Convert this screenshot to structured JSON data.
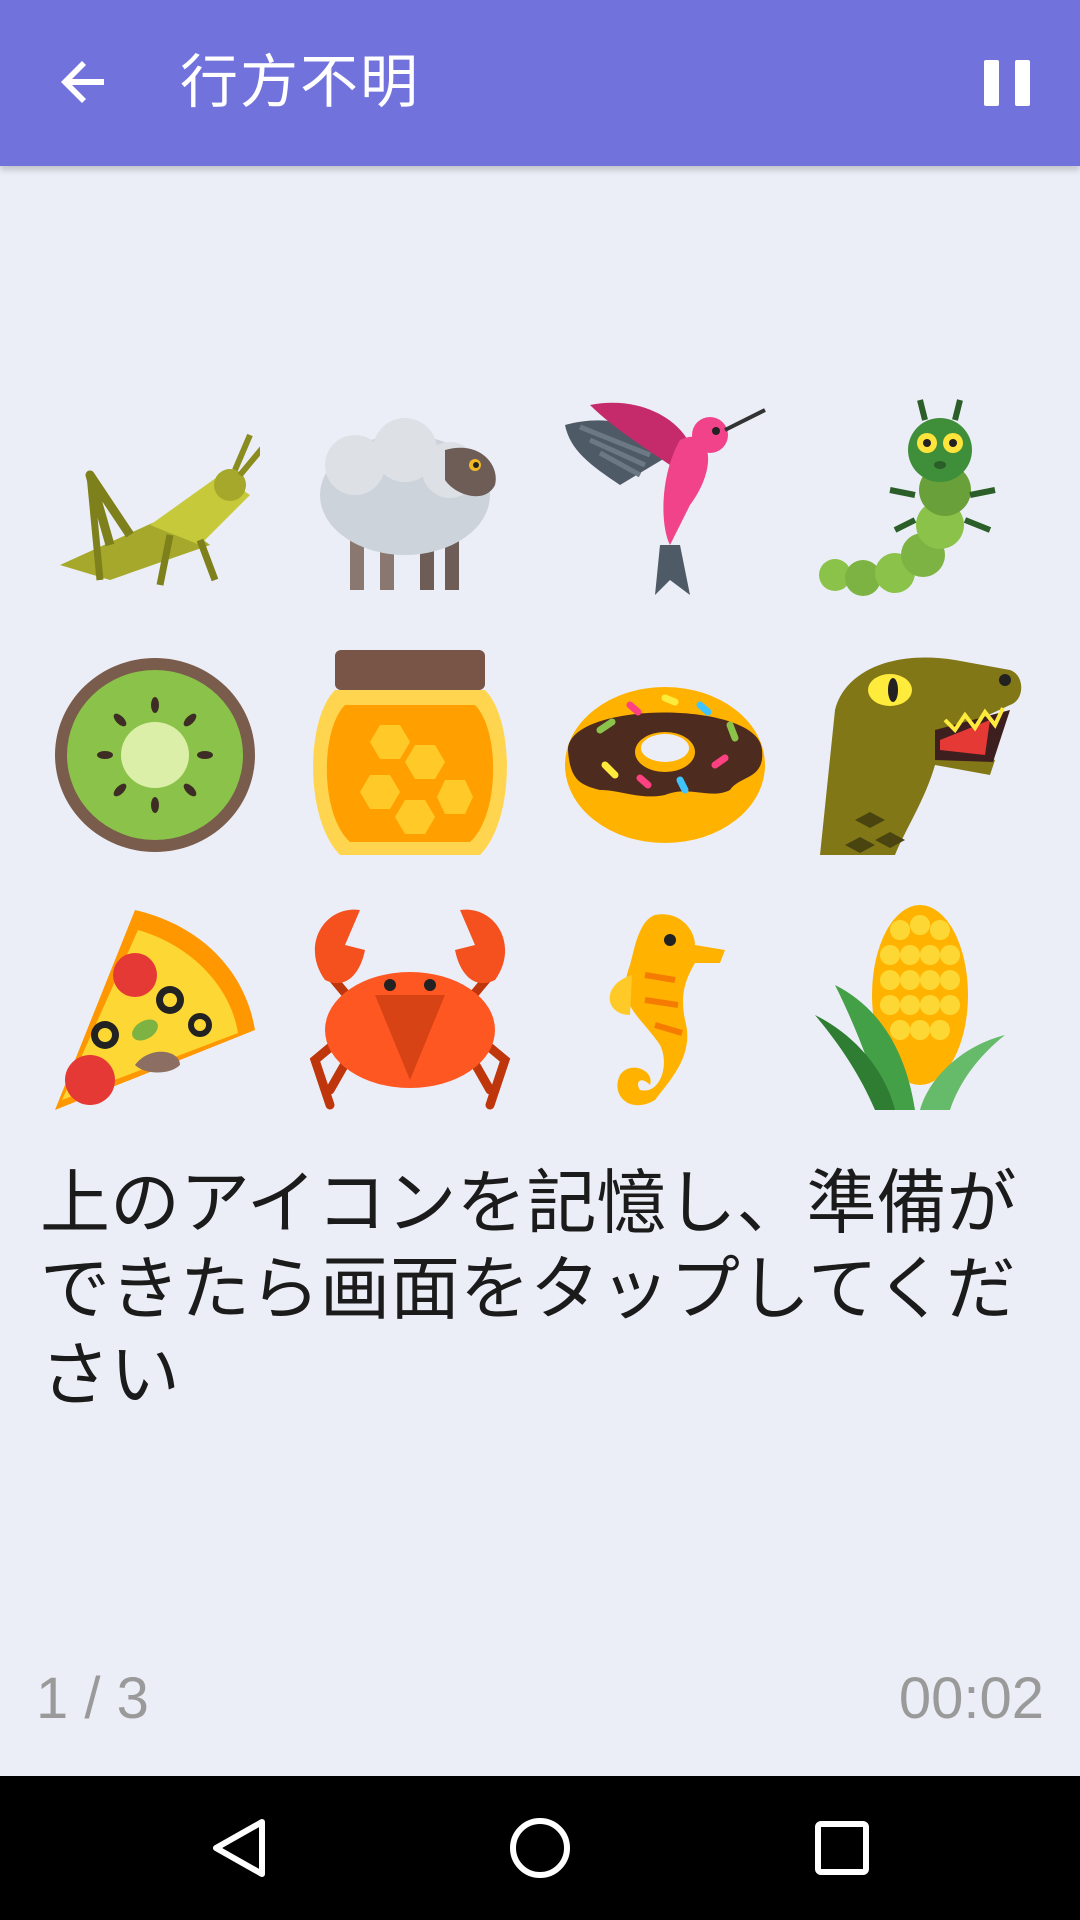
{
  "appbar": {
    "title": "行方不明",
    "back_icon": "arrow-back-icon",
    "pause_icon": "pause-icon",
    "background": "#7172dc"
  },
  "icons": [
    "grasshopper-icon",
    "sheep-icon",
    "hummingbird-icon",
    "caterpillar-icon",
    "kiwi-icon",
    "honey-jar-icon",
    "donut-icon",
    "dinosaur-icon",
    "pizza-icon",
    "crab-icon",
    "seahorse-icon",
    "corn-icon"
  ],
  "instruction": "上のアイコンを記憶し、準備ができたら画面をタップしてください",
  "footer": {
    "progress": "1 / 3",
    "timer": "00:02"
  },
  "system_nav": {
    "back_icon": "nav-back-icon",
    "home_icon": "nav-home-icon",
    "recents_icon": "nav-recents-icon"
  }
}
